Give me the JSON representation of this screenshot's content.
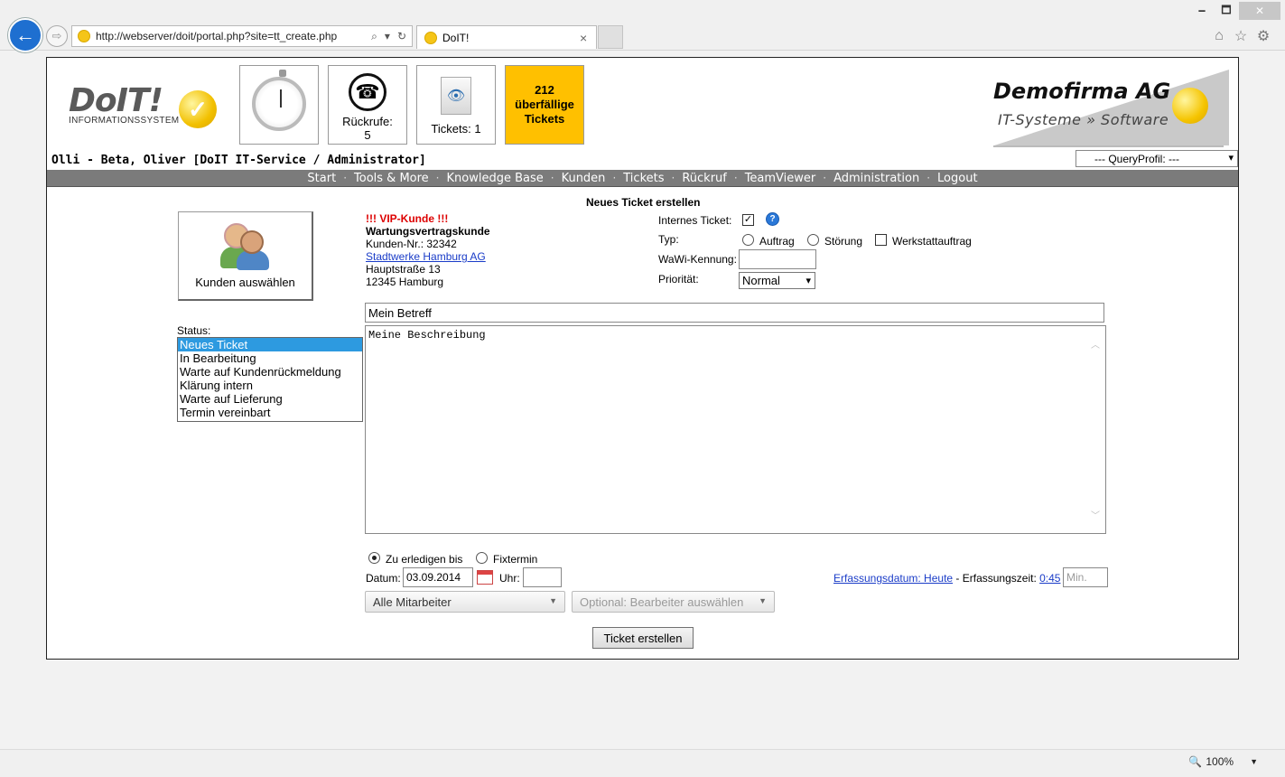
{
  "browser": {
    "url_prefix": "http://",
    "url_host": "webserver",
    "url_path": "/doit/portal.php?site=tt_create.php",
    "tab_title": "DoIT!",
    "tab_close": "×",
    "win_min": "🗕",
    "win_max": "🗖",
    "win_close": "✕",
    "back_glyph": "←",
    "forward_glyph": "⇨",
    "addr_search": "⌕",
    "addr_caret": "▾",
    "addr_refresh": "↻",
    "home_glyph": "⌂",
    "star_glyph": "☆",
    "gear_glyph": "⚙",
    "zoom": "100%",
    "zoom_icon": "🔍",
    "zoom_caret": "▼"
  },
  "header": {
    "logo_word": "DoIT!",
    "logo_sub": "INFORMATIONSSYSTEM",
    "logo_check": "✓",
    "callback_icon": "☎",
    "callback_label": "Rückrufe:",
    "callback_count": "5",
    "tickets_icon": "👁",
    "tickets_label": "Tickets: 1",
    "overdue_count": "212",
    "overdue_line1": "überfällige",
    "overdue_line2": "Tickets",
    "brand_name": "Demofirma AG",
    "brand_slogan": "IT-Systeme » Software",
    "user_line": "Olli - Beta, Oliver [DoIT IT-Service / Administrator]",
    "query_profile": "--- QueryProfil: ---",
    "select_caret": "▾"
  },
  "menu": {
    "sep": "·",
    "items": [
      "Start",
      "Tools & More",
      "Knowledge Base",
      "Kunden",
      "Tickets",
      "Rückruf",
      "TeamViewer",
      "Administration",
      "Logout"
    ]
  },
  "form": {
    "title": "Neues Ticket erstellen",
    "select_customer": "Kunden auswählen",
    "customer": {
      "vip": "!!! VIP-Kunde !!!",
      "contract": "Wartungsvertragskunde",
      "number": "Kunden-Nr.: 32342",
      "name": "Stadtwerke Hamburg AG",
      "street": "Hauptstraße 13",
      "city": "12345 Hamburg"
    },
    "internal_label": "Internes Ticket:",
    "internal_check": "✓",
    "help_glyph": "?",
    "type_label": "Typ:",
    "type_options": [
      "Auftrag",
      "Störung",
      "Werkstattauftrag"
    ],
    "wawi_label": "WaWi-Kennung:",
    "wawi_value": "",
    "priority_label": "Priorität:",
    "priority_value": "Normal",
    "status_label": "Status:",
    "status_options": [
      "Neues Ticket",
      "In Bearbeitung",
      "Warte auf Kundenrückmeldung",
      "Klärung intern",
      "Warte auf Lieferung",
      "Termin vereinbart"
    ],
    "status_selected": "Neues Ticket",
    "subject": "Mein Betreff",
    "description": "Meine Beschreibung",
    "scroll_up": "︿",
    "scroll_down": "﹀",
    "due_option_1": "Zu erledigen bis",
    "due_option_2": "Fixtermin",
    "date_label": "Datum:",
    "date_value": "03.09.2014",
    "time_label": "Uhr:",
    "time_value": "",
    "staff_select": "Alle Mitarbeiter",
    "assignee_select": "Optional: Bearbeiter auswählen",
    "dd_caret": "▼",
    "erf_link": "Erfassungsdatum: Heute",
    "erf_sep": " - Erfassungszeit: ",
    "erf_time": "0:45",
    "min_placeholder": "Min.",
    "submit": "Ticket erstellen"
  },
  "colors": {
    "menubar": "#7b7b7b",
    "overdue": "#ffc000",
    "vip": "#dd0000",
    "link": "#1a3cc8",
    "selection": "#2d9ae0"
  }
}
